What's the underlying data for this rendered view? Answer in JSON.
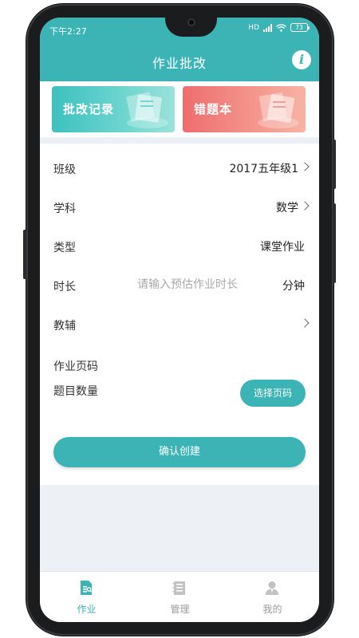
{
  "status_bar": {
    "time": "下午2:27",
    "network": "HD",
    "battery": "73"
  },
  "header": {
    "title": "作业批改",
    "info_icon": "i"
  },
  "banners": [
    {
      "label": "批改记录",
      "color": "#3dc0bf"
    },
    {
      "label": "错题本",
      "color": "#ee6d6f"
    }
  ],
  "form": {
    "class": {
      "label": "班级",
      "value": "2017五年级1"
    },
    "subject": {
      "label": "学科",
      "value": "数学"
    },
    "type": {
      "label": "类型",
      "value": "课堂作业"
    },
    "duration": {
      "label": "时长",
      "placeholder": "请输入预估作业时长",
      "unit": "分钟"
    },
    "tutor": {
      "label": "教辅"
    },
    "pages": {
      "label": "作业页码",
      "count_label": "题目数量",
      "button": "选择页码"
    },
    "confirm": "确认创建"
  },
  "tabs": [
    {
      "label": "作业",
      "icon": "homework-icon",
      "active": true
    },
    {
      "label": "管理",
      "icon": "manage-icon",
      "active": false
    },
    {
      "label": "我的",
      "icon": "profile-icon",
      "active": false
    }
  ],
  "colors": {
    "accent": "#3cb3b4",
    "background": "#edf0f5"
  }
}
